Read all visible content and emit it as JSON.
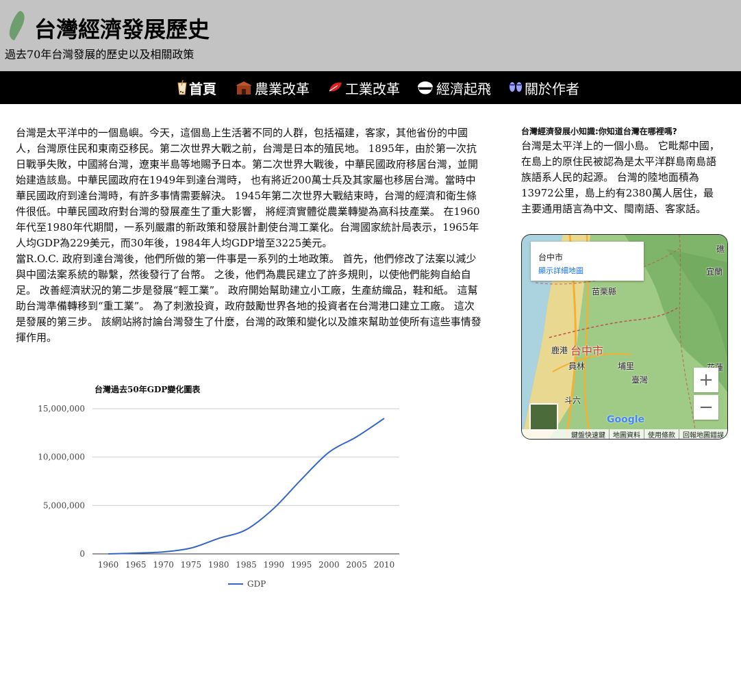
{
  "header": {
    "title": "台灣經濟發展歷史",
    "subtitle": "過去70年台灣發展的歷史以及相關政策",
    "logo_icon": "taiwan-island-icon"
  },
  "nav": {
    "items": [
      {
        "label": "首頁",
        "icon": "drink-cup-icon",
        "active": true
      },
      {
        "label": "農業改革",
        "icon": "temple-icon",
        "active": false
      },
      {
        "label": "工業改革",
        "icon": "red-leaf-icon",
        "active": false
      },
      {
        "label": "經濟起飛",
        "icon": "rice-bowl-icon",
        "active": false
      },
      {
        "label": "關於作者",
        "icon": "slippers-icon",
        "active": false
      }
    ]
  },
  "article": {
    "paragraphs": [
      "台灣是太平洋中的一個島嶼。今天，這個島上生活著不同的人群，包括福建，客家，其他省份的中國人，台灣原住民和東南亞移民。第二次世界大戰之前，台灣是日本的殖民地。 1895年，由於第一次抗日戰爭失敗，中國將台灣，遼東半島等地賜予日本。第二次世界大戰後，中華民國政府移居台灣，並開始建造該島。中華民國政府在1949年到達台灣時， 也有將近200萬士兵及其家屬也移居台灣。當時中華民國政府到達台灣時，有許多事情需要解決。 1945年第二次世界大戰結束時，台灣的經濟和衛生條件很低。中華民國政府對台灣的發展產生了重大影響， 將經濟實體從農業轉變為高科技產業。 在1960年代至1980年代期間，一系列嚴肅的新政策和發展計劃使台灣工業化。台灣國家統計局表示，1965年人均GDP為229美元，而30年後，1984年人均GDP增至3225美元。",
      "當R.O.C. 政府到達台灣後，他們所做的第一件事是一系列的土地政策。 首先，他們修改了法案以減少與中國法案系統的聯繫，然後發行了台幣。 之後，他們為農民建立了許多規則，以使他們能夠自給自足。 改善經濟狀況的第二步是發展“輕工業”。 政府開始幫助建立小工廠，生產紡織品，鞋和紙。 這幫助台灣準備轉移到“重工業”。 為了刺激投資，政府鼓勵世界各地的投資者在台灣港口建立工廠。 這次是發展的第三步。 該網站將討論台灣發生了什麼，台灣的政策和變化以及誰來幫助並使所有這些事情發揮作用。"
    ]
  },
  "chart_data": {
    "type": "line",
    "title": "台灣過去50年GDP變化圖表",
    "xlabel": "",
    "ylabel": "",
    "x": [
      1960,
      1965,
      1970,
      1975,
      1980,
      1985,
      1990,
      1995,
      2000,
      2005,
      2010
    ],
    "series": [
      {
        "name": "GDP",
        "values": [
          0,
          80000,
          200000,
          600000,
          1600000,
          2500000,
          4700000,
          7700000,
          10500000,
          12100000,
          14000000
        ]
      }
    ],
    "ylim": [
      0,
      15000000
    ],
    "y_ticks": [
      "0",
      "5,000,000",
      "10,000,000",
      "15,000,000"
    ],
    "x_ticks": [
      "1960",
      "1965",
      "1970",
      "1975",
      "1980",
      "1985",
      "1990",
      "1995",
      "2000",
      "2005",
      "2010"
    ],
    "legend_placement": "bottom",
    "grid": true,
    "line_color": "#3366cc"
  },
  "sidebar": {
    "heading": "台灣經濟發展小知識:你知道台灣在哪裡嗎?",
    "text": "台灣是太平洋上的一個小島。 它毗鄰中國，在島上的原住民被認為是太平洋群島南島語族語系人民的起源。 台灣的陸地面積為13972公里，島上約有2380萬人居住，最主要通用語言為中文、閩南語、客家話。"
  },
  "map": {
    "place_name": "台中市",
    "details_link": "顯示詳細地圖",
    "labels": {
      "city": "台中市",
      "miaoli": "苗栗縣",
      "yilan": "宜蘭",
      "lugang": "鹿港",
      "yuanlin": "員林",
      "puli": "埔里",
      "taiwan": "臺灣",
      "douliu": "斗六",
      "ji": "礁",
      "hualien_partial": "花蓮"
    },
    "zoom_in": "+",
    "zoom_out": "−",
    "google_logo": "Google",
    "footer": [
      "鍵盤快速鍵",
      "地圖資料",
      "使用條款",
      "回報地圖錯誤"
    ]
  }
}
